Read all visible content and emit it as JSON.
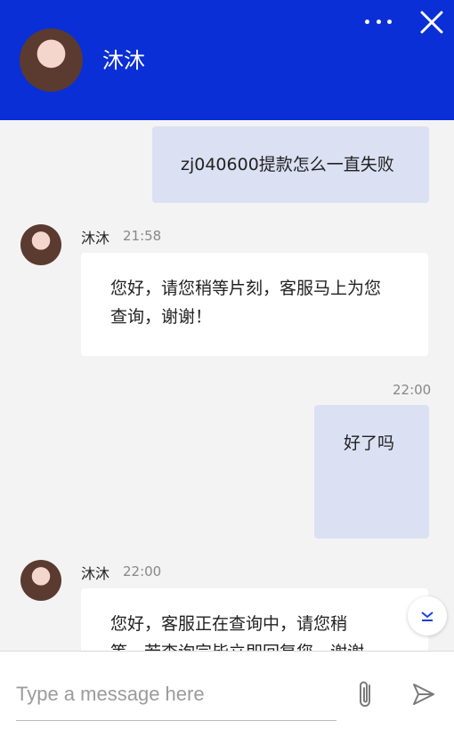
{
  "header": {
    "contact_name": "沐沐"
  },
  "messages": [
    {
      "type": "out",
      "text": "zj040600提款怎么一直失败"
    },
    {
      "type": "in",
      "sender": "沐沐",
      "time": "21:58",
      "text_line1": "您好，请您稍等片刻，客服马上为您",
      "text_line2": "查询，谢谢！"
    },
    {
      "type": "out",
      "time": "22:00",
      "text": "好了吗"
    },
    {
      "type": "in",
      "sender": "沐沐",
      "time": "22:00",
      "text_line1": "您好，客服正在查询中，请您稍",
      "text_line2": "等，若查询完毕立即回复您，谢谢"
    }
  ],
  "composer": {
    "placeholder": "Type a message here",
    "value": ""
  },
  "icons": {
    "more": "more-dots-icon",
    "close": "close-icon",
    "attach": "paperclip-icon",
    "send": "send-icon",
    "scroll": "chevron-down-icon"
  },
  "colors": {
    "header_bg": "#0a2fd6",
    "outgoing_bubble": "#dbe0f3",
    "incoming_bubble": "#ffffff",
    "chat_bg": "#f3f3f4"
  }
}
